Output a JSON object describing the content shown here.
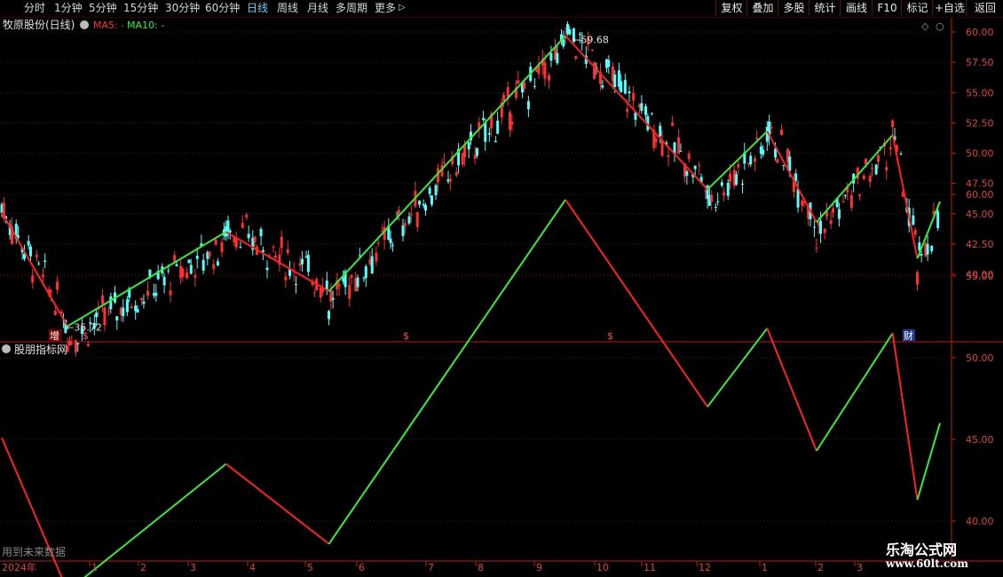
{
  "toolbar": {
    "periods": [
      "分时",
      "1分钟",
      "5分钟",
      "15分钟",
      "30分钟",
      "60分钟",
      "日线",
      "周线",
      "月线",
      "多周期",
      "更多"
    ],
    "selected": "日线",
    "more_arrow": "▷",
    "right_buttons": [
      "复权",
      "叠加",
      "多股",
      "统计",
      "画线",
      "F10",
      "标记",
      "+自选",
      "返回"
    ]
  },
  "main_panel": {
    "stock_title": "牧原股份(日线)",
    "ma5_label": "MA5: -",
    "ma10_label": "MA10: -",
    "high_label": "59.68",
    "low_label": "35.72",
    "event_markers": [
      "增",
      "$",
      "$",
      "$",
      "财"
    ],
    "colors": {
      "up": "#ff3030",
      "down": "#54ffff",
      "rise_line": "#33ee33",
      "fall_line": "#ff2020",
      "axis": "#c01818",
      "grid": "#5a1010"
    }
  },
  "indicator_panel": {
    "title": "股朋指标网",
    "footer_note": "用到未来数据"
  },
  "x_axis": {
    "year_label": "2024年",
    "month_labels": [
      "1",
      "2",
      "3",
      "4",
      "5",
      "6",
      "7",
      "8",
      "9",
      "10",
      "11",
      "12",
      "1",
      "2",
      "3"
    ]
  },
  "watermark": {
    "line1": "乐淘公式网",
    "line2": "www.60lt.com"
  },
  "chart_data": [
    {
      "type": "line",
      "title": "牧原股份(日线)",
      "y_ticks": [
        "60.00",
        "57.50",
        "55.00",
        "52.50",
        "50.00",
        "47.50",
        "45.00",
        "42.50",
        "40.00"
      ],
      "ylim": [
        37.5,
        60.5
      ],
      "zigzag_points": [
        {
          "x": "2023-12-28",
          "y": 45.1
        },
        {
          "x": "2024-01-29",
          "y": 35.72
        },
        {
          "x": "2024-04-15",
          "y": 43.5
        },
        {
          "x": "2024-06-04",
          "y": 38.6
        },
        {
          "x": "2024-09-27",
          "y": 59.68
        },
        {
          "x": "2024-12-05",
          "y": 47.0
        },
        {
          "x": "2025-01-03",
          "y": 51.8
        },
        {
          "x": "2025-01-27",
          "y": 44.3
        },
        {
          "x": "2025-03-05",
          "y": 51.5
        },
        {
          "x": "2025-03-17",
          "y": 41.3
        },
        {
          "x": "2025-03-28",
          "y": 46.0
        }
      ]
    },
    {
      "type": "line",
      "title": "股朋指标网",
      "y_ticks": [
        "60.00",
        "55.00",
        "50.00",
        "45.00",
        "40.00"
      ],
      "ylim": [
        37.5,
        61.5
      ],
      "series": [
        {
          "values_from": "zigzag_points"
        }
      ]
    }
  ]
}
